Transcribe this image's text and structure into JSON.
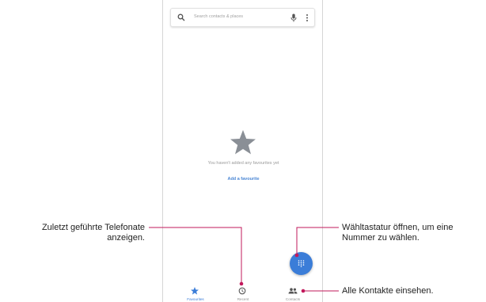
{
  "search": {
    "placeholder": "Search contacts & places"
  },
  "empty_state": {
    "message": "You haven't added any favourites yet",
    "add_link": "Add a favourite"
  },
  "bottom_nav": [
    {
      "label": "Favourites",
      "icon": "star-icon",
      "active": true
    },
    {
      "label": "Recent",
      "icon": "clock-icon",
      "active": false
    },
    {
      "label": "Contacts",
      "icon": "people-icon",
      "active": false
    }
  ],
  "fab": {
    "icon": "dialpad-icon"
  },
  "callouts": {
    "recent_line1": "Zuletzt geführte Telefonate",
    "recent_line2": "anzeigen.",
    "dialpad_line1": "Wähltastatur öffnen, um eine",
    "dialpad_line2": "Nummer zu wählen.",
    "contacts": "Alle Kontakte einsehen."
  },
  "colors": {
    "accent": "#3b7dd8",
    "leader_line": "#c2185b",
    "star": "#8a8f96"
  }
}
